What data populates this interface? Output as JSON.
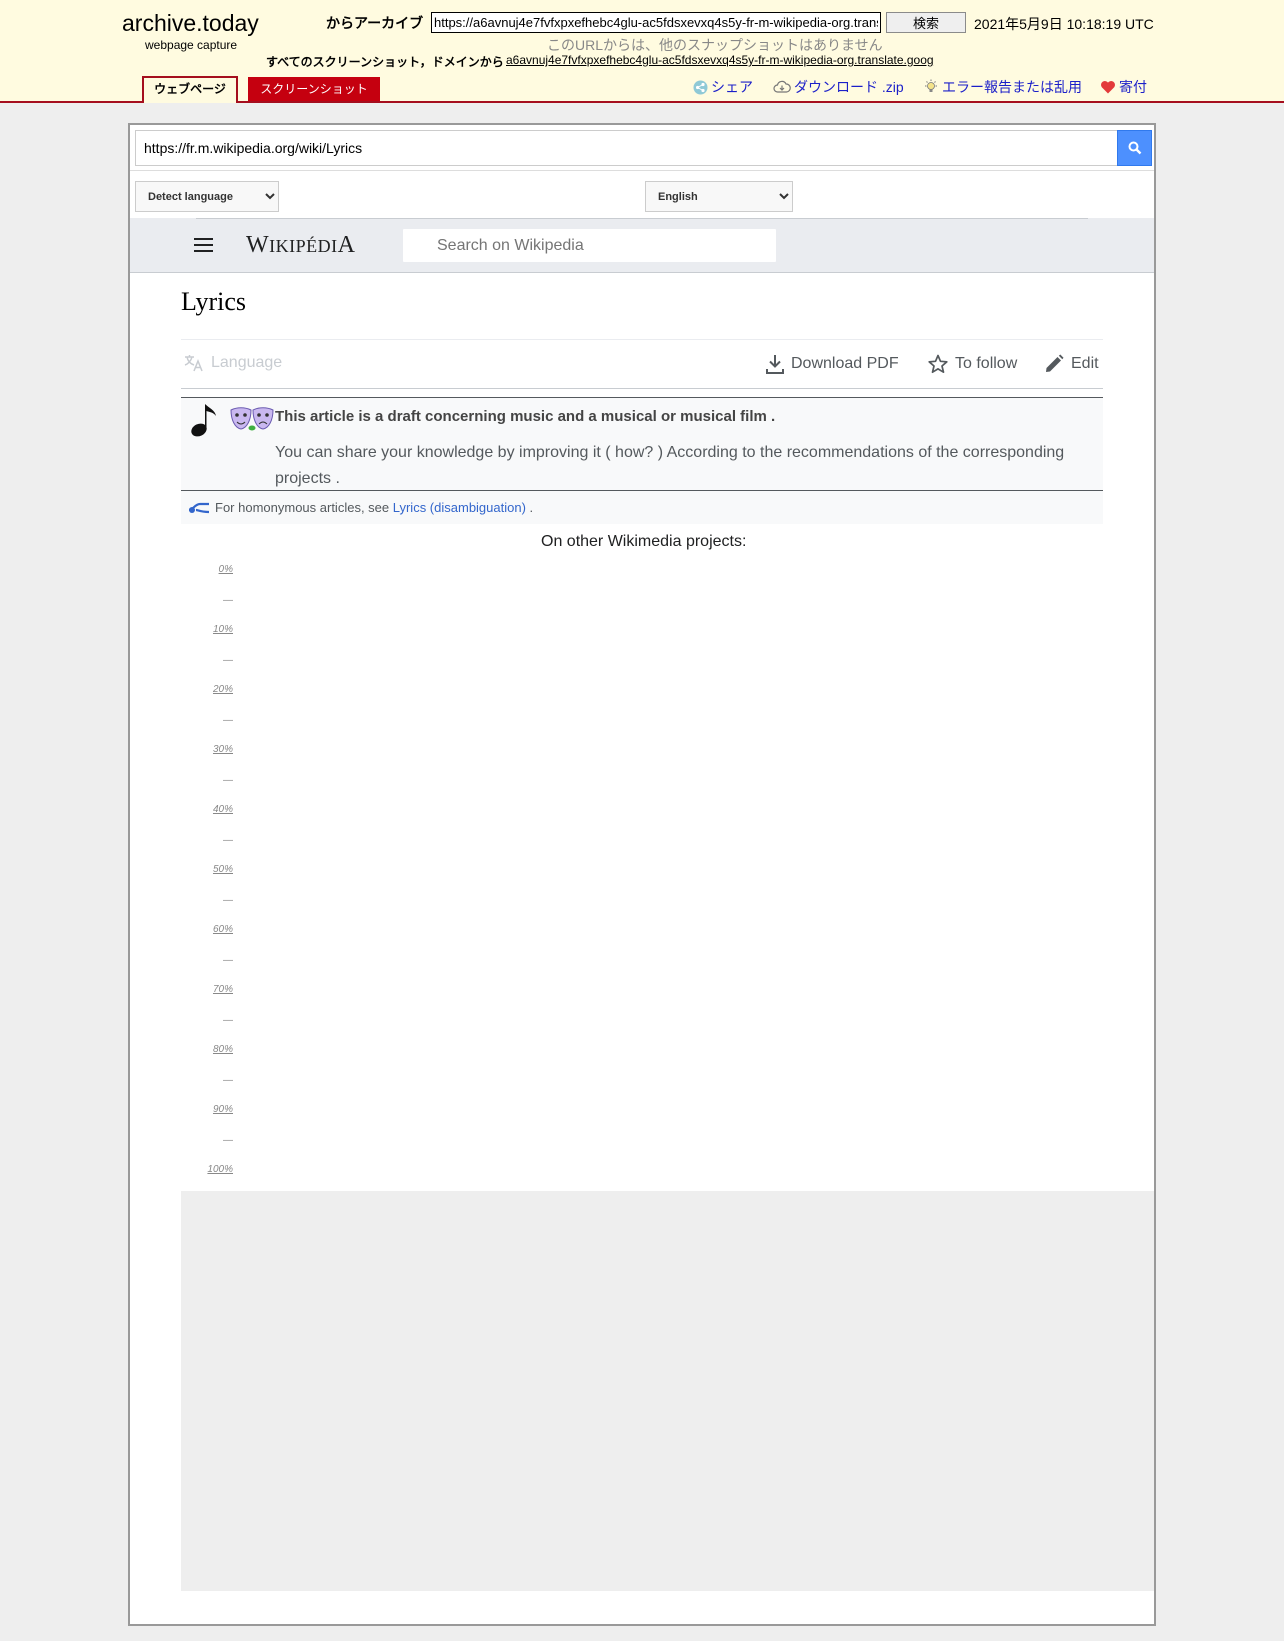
{
  "archive": {
    "logo": "archive.today",
    "logo_sub": "webpage capture",
    "from_label": "からアーカイブ",
    "url_value": "https://a6avnuj4e7fvfxpxefhebc4glu-ac5fdsxevxq4s5y-fr-m-wikipedia-org.translate.goog",
    "search_label": "検索",
    "date": "2021年5月9日 10:18:19 UTC",
    "no_snapshots_note": "このURLからは、他のスナップショットはありません",
    "all_screenshots_label": "すべてのスクリーンショット，ドメインから",
    "domain_link": "a6avnuj4e7fvfxpxefhebc4glu-ac5fdsxevxq4s5y-fr-m-wikipedia-org.translate.goog",
    "tabs": {
      "webpage": "ウェブページ",
      "screenshot": "スクリーンショット"
    },
    "actions": {
      "share": "シェア",
      "download": "ダウンロード .zip",
      "report": "エラー報告または乱用",
      "donate": "寄付"
    },
    "colors": {
      "header_bg": "#fffbe0",
      "accent": "#a50e1e",
      "link": "#1b1fc9"
    }
  },
  "translate": {
    "url_value": "https://fr.m.wikipedia.org/wiki/Lyrics",
    "source_language": "Detect language",
    "target_language": "English"
  },
  "wiki": {
    "logo_parts": {
      "w": "W",
      "ikip": "IKIP",
      "e": "É",
      "di": "DI",
      "a": "A"
    },
    "search_placeholder": "Search on Wikipedia",
    "title": "Lyrics",
    "language_label": "Language",
    "download_pdf_label": "Download PDF",
    "follow_label": "To follow",
    "edit_label": "Edit",
    "draft_title": "This article is a draft concerning music and a musical or musical film .",
    "draft_body": "You can share your knowledge by improving it ( how? ) According to the recommendations of the corresponding projects .",
    "homonymy_prefix": "For homonymous articles, see ",
    "homonymy_link": "Lyrics (disambiguation)",
    "homonymy_suffix": " .",
    "other_projects": "On other Wikimedia projects:",
    "scale_labels": [
      "0%",
      "10%",
      "20%",
      "30%",
      "40%",
      "50%",
      "60%",
      "70%",
      "80%",
      "90%",
      "100%"
    ],
    "scale_tick": "—"
  },
  "icons": {
    "share": "share-icon",
    "download": "cloud-download-icon",
    "report": "bulb-icon",
    "donate": "heart-icon",
    "translate_go": "search-icon",
    "menu": "hamburger-menu-icon",
    "language": "translate-icon",
    "pdf": "download-icon",
    "follow": "star-icon",
    "edit": "pencil-icon",
    "draft_note": "music-note-icon",
    "draft_masks": "theatre-masks-icon",
    "homonymy": "disambiguation-icon"
  }
}
